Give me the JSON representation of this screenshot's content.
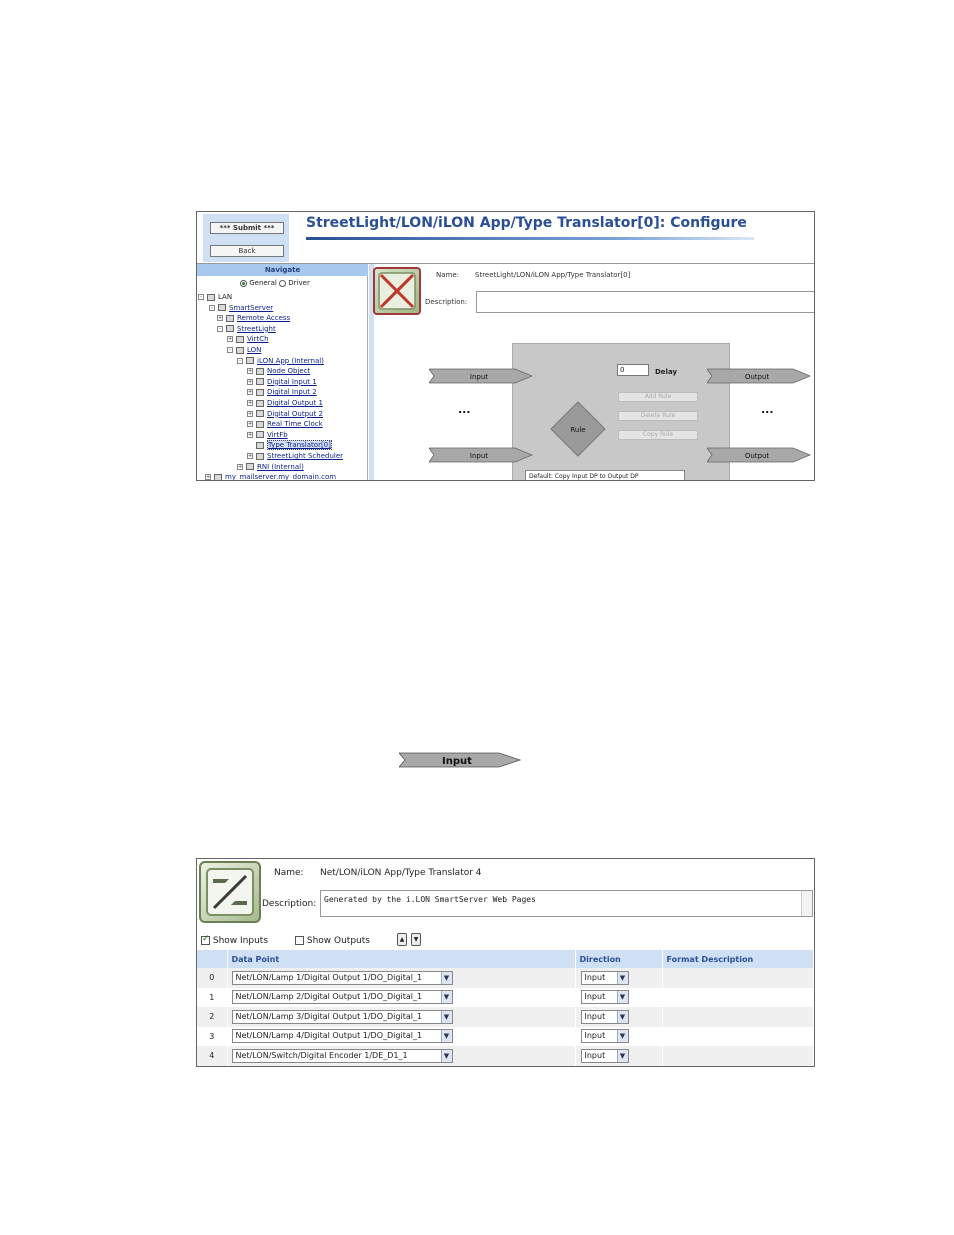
{
  "screen1": {
    "submit_label": "*** Submit ***",
    "back_label": "Back",
    "title": "StreetLight/LON/iLON App/Type Translator[0]: Configure",
    "navigate_label": "Navigate",
    "radio_general": "General",
    "radio_driver": "Driver",
    "tree": [
      {
        "label": "LAN"
      },
      {
        "label": "SmartServer"
      },
      {
        "label": "Remote Access"
      },
      {
        "label": "StreetLight"
      },
      {
        "label": "VirtCh"
      },
      {
        "label": "LON"
      },
      {
        "label": "iLON App (Internal)"
      },
      {
        "label": "Node Object"
      },
      {
        "label": "Digital Input 1"
      },
      {
        "label": "Digital Input 2"
      },
      {
        "label": "Digital Output 1"
      },
      {
        "label": "Digital Output 2"
      },
      {
        "label": "Real Time Clock"
      },
      {
        "label": "VirtFb"
      },
      {
        "label": "Type Translator[0]"
      },
      {
        "label": "StreetLight Scheduler"
      },
      {
        "label": "RNI (Internal)"
      },
      {
        "label": "my_mailserver.my_domain.com"
      }
    ],
    "name_label": "Name:",
    "name_value": "StreetLight/LON/iLON App/Type Translator[0]",
    "description_label": "Description:",
    "input_label": "Input",
    "output_label": "Output",
    "dots": "...",
    "delay_value": "0",
    "delay_label": "Delay",
    "add_rule": "Add Rule",
    "delete_rule": "Delete Rule",
    "copy_rule": "Copy Rule",
    "rule_label": "Rule",
    "rule_select": "Default: Copy Input DP to Output DP"
  },
  "input_arrow_label": "Input",
  "screen2": {
    "name_label": "Name:",
    "name_value": "Net/LON/iLON App/Type Translator 4",
    "description_label": "Description:",
    "description_value": "Generated by the i.LON SmartServer Web Pages",
    "show_inputs": "Show Inputs",
    "show_outputs": "Show Outputs",
    "move_up": "▲",
    "move_down": "▼",
    "columns": [
      "Data Point",
      "Direction",
      "Format Description"
    ],
    "rows": [
      {
        "index": "0",
        "data_point": "Net/LON/Lamp 1/Digital Output 1/DO_Digital_1",
        "direction": "Input"
      },
      {
        "index": "1",
        "data_point": "Net/LON/Lamp 2/Digital Output 1/DO_Digital_1",
        "direction": "Input"
      },
      {
        "index": "2",
        "data_point": "Net/LON/Lamp 3/Digital Output 1/DO_Digital_1",
        "direction": "Input"
      },
      {
        "index": "3",
        "data_point": "Net/LON/Lamp 4/Digital Output 1/DO_Digital_1",
        "direction": "Input"
      },
      {
        "index": "4",
        "data_point": "Net/LON/Switch/Digital Encoder 1/DE_D1_1",
        "direction": "Input"
      }
    ]
  }
}
